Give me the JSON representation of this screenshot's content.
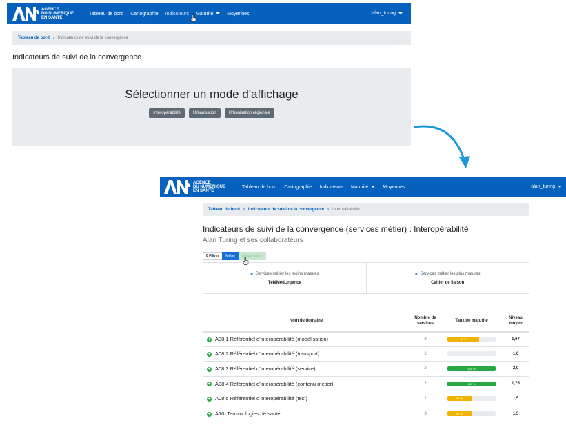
{
  "brand": {
    "line1": "AGENCE",
    "line2": "DU NUMERIQUE",
    "line3": "EN SANTÉ"
  },
  "screen1": {
    "nav": {
      "items": [
        {
          "label": "Tableau de bord",
          "dropdown": false
        },
        {
          "label": "Cartographie",
          "dropdown": false
        },
        {
          "label": "Indicateurs",
          "dropdown": false
        },
        {
          "label": "Maturité",
          "dropdown": true
        },
        {
          "label": "Moyennes",
          "dropdown": false
        }
      ],
      "user": "alan_turing"
    },
    "breadcrumb": {
      "home": "Tableau de bord",
      "separator": "›",
      "current": "Indicateurs de suivi de la convergence"
    },
    "title": "Indicateurs de suivi de la convergence",
    "hero": {
      "title": "Sélectionner un mode d'affichage",
      "buttons": [
        "Interopérabilité",
        "Urbanisation",
        "Urbanisation régionale"
      ]
    }
  },
  "screen2": {
    "nav": {
      "items": [
        {
          "label": "Tableau de bord",
          "dropdown": false
        },
        {
          "label": "Cartographie",
          "dropdown": false
        },
        {
          "label": "Indicateurs",
          "dropdown": false
        },
        {
          "label": "Maturité",
          "dropdown": true
        },
        {
          "label": "Moyennes",
          "dropdown": false
        }
      ],
      "user": "alan_turing"
    },
    "breadcrumb": {
      "home": "Tableau de bord",
      "parent": "Indicateurs de suivi de la convergence",
      "separator": "›",
      "current": "Interopérabilité"
    },
    "title": "Indicateurs de suivi de la convergence (services métier) : Interopérabilité",
    "subtitle": "Alan Turing et ses collaborateurs",
    "filters": {
      "count": "0",
      "label": "Filtres",
      "active": "Métier",
      "other": "Infrastructure"
    },
    "cards": [
      {
        "heading": "Services métier les moins matures",
        "value": "TéléMédUrgence",
        "icon": "chevron-double-down-icon"
      },
      {
        "heading": "Services métier les plus matures",
        "value": "Cahier de liaison",
        "icon": "chevron-double-up-icon"
      }
    ],
    "table": {
      "headers": {
        "domain": "Nom de domaine",
        "services": "Nombre de services",
        "rate": "Taux de maturité",
        "level": "Niveau moyen"
      },
      "rows": [
        {
          "name": "A08.1 Référentiel d'interopérabilité (modélisation)",
          "services": "3",
          "rate_pct": 66,
          "rate_label": "66 %",
          "rate_color": "#f0b400",
          "level": "1,67"
        },
        {
          "name": "A08.2 Référentiel d'interopérabilité (transport)",
          "services": "2",
          "rate_pct": 0,
          "rate_label": "",
          "rate_color": "#f0b400",
          "level": "1,0"
        },
        {
          "name": "A08.3 Référentiel d'interopérabilité (service)",
          "services": "2",
          "rate_pct": 100,
          "rate_label": "100 %",
          "rate_color": "#28a745",
          "level": "2,0"
        },
        {
          "name": "A08.4 Référentiel d'interopérabilité (contenu métier)",
          "services": "2",
          "rate_pct": 100,
          "rate_label": "100 %",
          "rate_color": "#28a745",
          "level": "1,75"
        },
        {
          "name": "A08.5 Référentiel d'interopérabilité (test)",
          "services": "2",
          "rate_pct": 50,
          "rate_label": "50 %",
          "rate_color": "#f0b400",
          "level": "1,5"
        },
        {
          "name": "A10. Terminologies de santé",
          "services": "3",
          "rate_pct": 50,
          "rate_label": "50 %",
          "rate_color": "#f0b400",
          "level": "1,5"
        }
      ]
    }
  },
  "colors": {
    "navbar": "#0560be",
    "accent": "#1470d6",
    "success": "#28a745",
    "warning": "#f0b400",
    "arrow": "#1a9ad9"
  }
}
